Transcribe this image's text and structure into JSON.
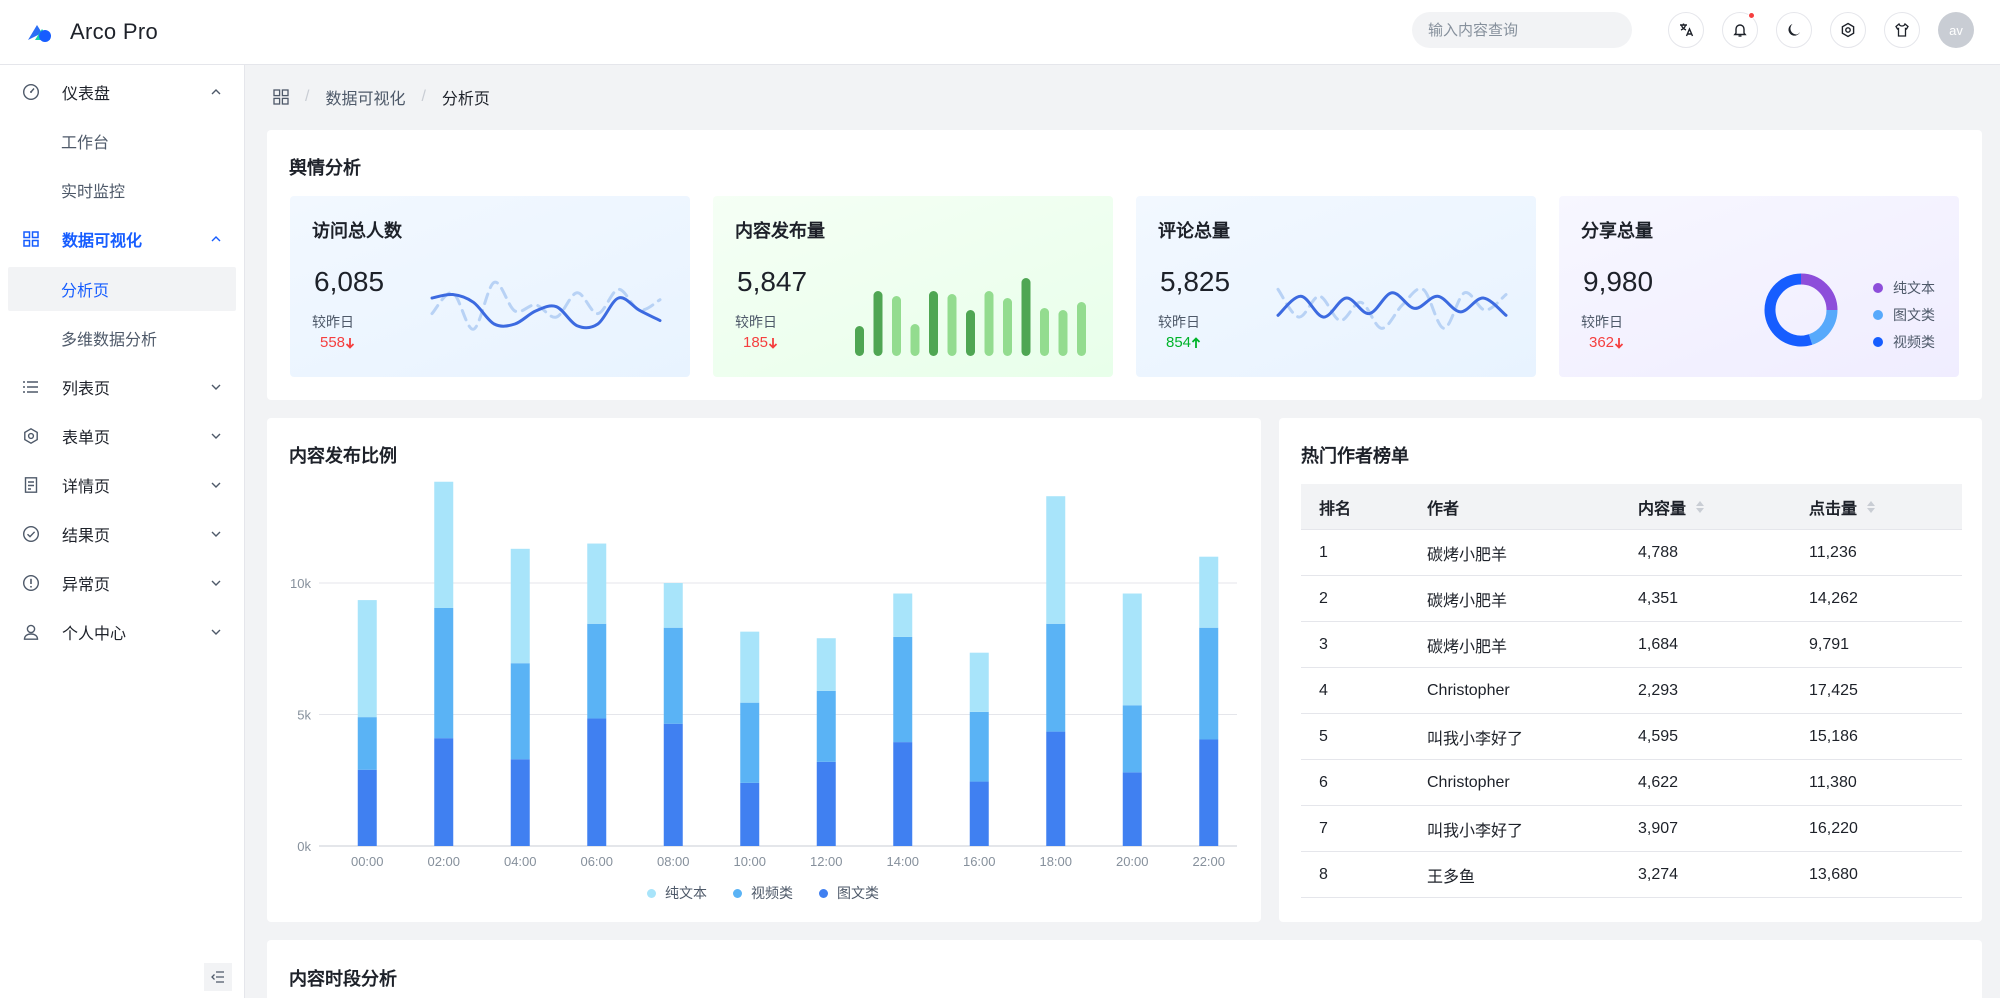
{
  "app": {
    "title": "Arco Pro"
  },
  "header": {
    "search_placeholder": "输入内容查询",
    "avatar_text": "av"
  },
  "sidebar": {
    "items": [
      {
        "label": "仪表盘",
        "expanded": true,
        "icon": "dashboard-icon"
      },
      {
        "label": "工作台"
      },
      {
        "label": "实时监控"
      },
      {
        "label": "数据可视化",
        "expanded": true,
        "icon": "grid-icon"
      },
      {
        "label": "分析页"
      },
      {
        "label": "多维数据分析"
      },
      {
        "label": "列表页",
        "icon": "list-icon"
      },
      {
        "label": "表单页",
        "icon": "settings-icon"
      },
      {
        "label": "详情页",
        "icon": "file-icon"
      },
      {
        "label": "结果页",
        "icon": "check-circle-icon"
      },
      {
        "label": "异常页",
        "icon": "exclamation-icon"
      },
      {
        "label": "个人中心",
        "icon": "user-icon"
      }
    ]
  },
  "breadcrumb": [
    "数据可视化",
    "分析页"
  ],
  "overview": {
    "title": "舆情分析",
    "cards": [
      {
        "title": "访问总人数",
        "value": "6,085",
        "compare_label": "较昨日",
        "diff": "558",
        "trend": "down"
      },
      {
        "title": "内容发布量",
        "value": "5,847",
        "compare_label": "较昨日",
        "diff": "185",
        "trend": "down"
      },
      {
        "title": "评论总量",
        "value": "5,825",
        "compare_label": "较昨日",
        "diff": "854",
        "trend": "up"
      },
      {
        "title": "分享总量",
        "value": "9,980",
        "compare_label": "较昨日",
        "diff": "362",
        "trend": "down"
      }
    ],
    "share_legend": [
      "纯文本",
      "图文类",
      "视频类"
    ],
    "share_colors": [
      "#8d4eda",
      "#57a9fb",
      "#165dff"
    ]
  },
  "content_ratio": {
    "title": "内容发布比例",
    "legend": [
      "纯文本",
      "视频类",
      "图文类"
    ],
    "colors": [
      "#a8e4fa",
      "#5ab3f5",
      "#4080f1"
    ]
  },
  "hot_authors": {
    "title": "热门作者榜单",
    "columns": [
      "排名",
      "作者",
      "内容量",
      "点击量"
    ],
    "rows": [
      [
        "1",
        "碳烤小肥羊",
        "4,788",
        "11,236"
      ],
      [
        "2",
        "碳烤小肥羊",
        "4,351",
        "14,262"
      ],
      [
        "3",
        "碳烤小肥羊",
        "1,684",
        "9,791"
      ],
      [
        "4",
        "Christopher",
        "2,293",
        "17,425"
      ],
      [
        "5",
        "叫我小李好了",
        "4,595",
        "15,186"
      ],
      [
        "6",
        "Christopher",
        "4,622",
        "11,380"
      ],
      [
        "7",
        "叫我小李好了",
        "3,907",
        "16,220"
      ],
      [
        "8",
        "王多鱼",
        "3,274",
        "13,680"
      ]
    ]
  },
  "content_time": {
    "title": "内容时段分析"
  },
  "chart_data": [
    {
      "type": "bar",
      "stacked": true,
      "categories": [
        "00:00",
        "02:00",
        "04:00",
        "06:00",
        "08:00",
        "10:00",
        "12:00",
        "14:00",
        "16:00",
        "18:00",
        "20:00",
        "22:00"
      ],
      "series": [
        {
          "name": "图文类",
          "values": [
            2900,
            4100,
            3300,
            4850,
            4650,
            2400,
            3200,
            3950,
            2450,
            4350,
            2800,
            4050
          ]
        },
        {
          "name": "视频类",
          "values": [
            2000,
            4950,
            3650,
            3600,
            3650,
            3050,
            2700,
            4000,
            2650,
            4100,
            2550,
            4250
          ]
        },
        {
          "name": "纯文本",
          "values": [
            4450,
            4800,
            4350,
            3050,
            1700,
            2700,
            2000,
            1650,
            2250,
            4850,
            4250,
            2700
          ]
        }
      ],
      "yticks": [
        "0k",
        "5k",
        "10k"
      ],
      "ylim": [
        0,
        14000
      ]
    },
    {
      "type": "line",
      "title": "访问总人数",
      "series": [
        {
          "values": [
            60,
            64,
            55,
            30,
            30,
            45,
            50,
            28,
            30,
            60,
            46,
            34
          ]
        },
        {
          "values": [
            42,
            66,
            24,
            78,
            45,
            52,
            38,
            66,
            42,
            70,
            46,
            58
          ]
        }
      ]
    },
    {
      "type": "bar",
      "title": "内容发布量",
      "values": [
        3,
        6.5,
        6,
        3.2,
        6.5,
        6.2,
        4.6,
        6.5,
        5.8,
        7.8,
        4.8,
        4.6,
        5.4
      ]
    },
    {
      "type": "line",
      "title": "评论总量",
      "series": [
        {
          "values": [
            40,
            62,
            38,
            60,
            42,
            66,
            48,
            62,
            44,
            60,
            40
          ]
        },
        {
          "values": [
            70,
            38,
            62,
            34,
            55,
            25,
            52,
            70,
            25,
            66,
            46,
            64
          ]
        }
      ]
    },
    {
      "type": "pie",
      "title": "分享总量",
      "labels": [
        "纯文本",
        "图文类",
        "视频类"
      ],
      "values": [
        25,
        20,
        55
      ]
    }
  ]
}
